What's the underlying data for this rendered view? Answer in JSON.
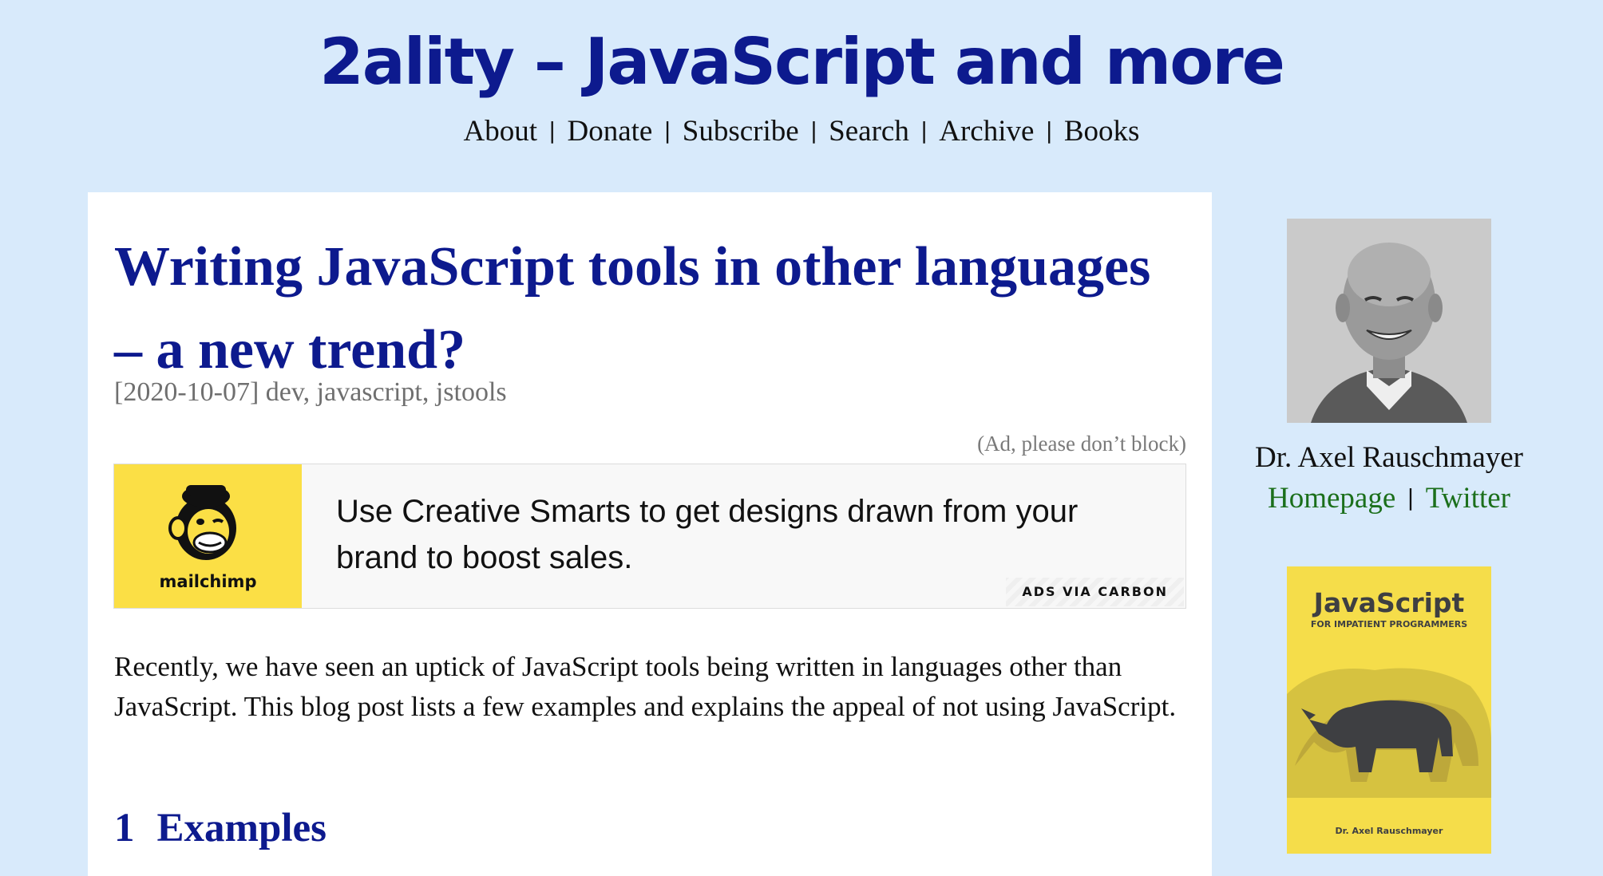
{
  "site": {
    "title": "2ality – JavaScript and more",
    "nav": [
      "About",
      "Donate",
      "Subscribe",
      "Search",
      "Archive",
      "Books"
    ],
    "nav_separator": "|"
  },
  "post": {
    "title": "Writing JavaScript tools in other lan­guages – a new trend?",
    "meta": "[2020-10-07] dev, javascript, jstools",
    "ad_note": "(Ad, please don’t block)",
    "intro": "Recently, we have seen an uptick of JavaScript tools being written in languages oth­er than JavaScript. This blog post lists a few examples and explains the appeal of not using JavaScript.",
    "section_number": "1",
    "section_title": "Examples"
  },
  "ad": {
    "brand": "mailchimp",
    "text": "Use Creative Smarts to get designs drawn from your brand to boost sales.",
    "via": "ADS VIA CARBON",
    "logo_icon": "mailchimp-monkey-icon"
  },
  "sidebar": {
    "author_name": "Dr. Axel Rauschmayer",
    "links": [
      "Homepage",
      "Twitter"
    ],
    "link_separator": "|",
    "book": {
      "title": "JavaScript",
      "subtitle": "FOR IMPATIENT PROGRAMMERS",
      "author": "Dr. Axel Rauschmayer",
      "icon": "rhino-illustration"
    }
  },
  "colors": {
    "background": "#d8eafb",
    "title_blue": "#0d1a8e",
    "link_green": "#1b6f1b",
    "ad_yellow": "#fbdf45",
    "book_yellow": "#f5dd4a"
  }
}
